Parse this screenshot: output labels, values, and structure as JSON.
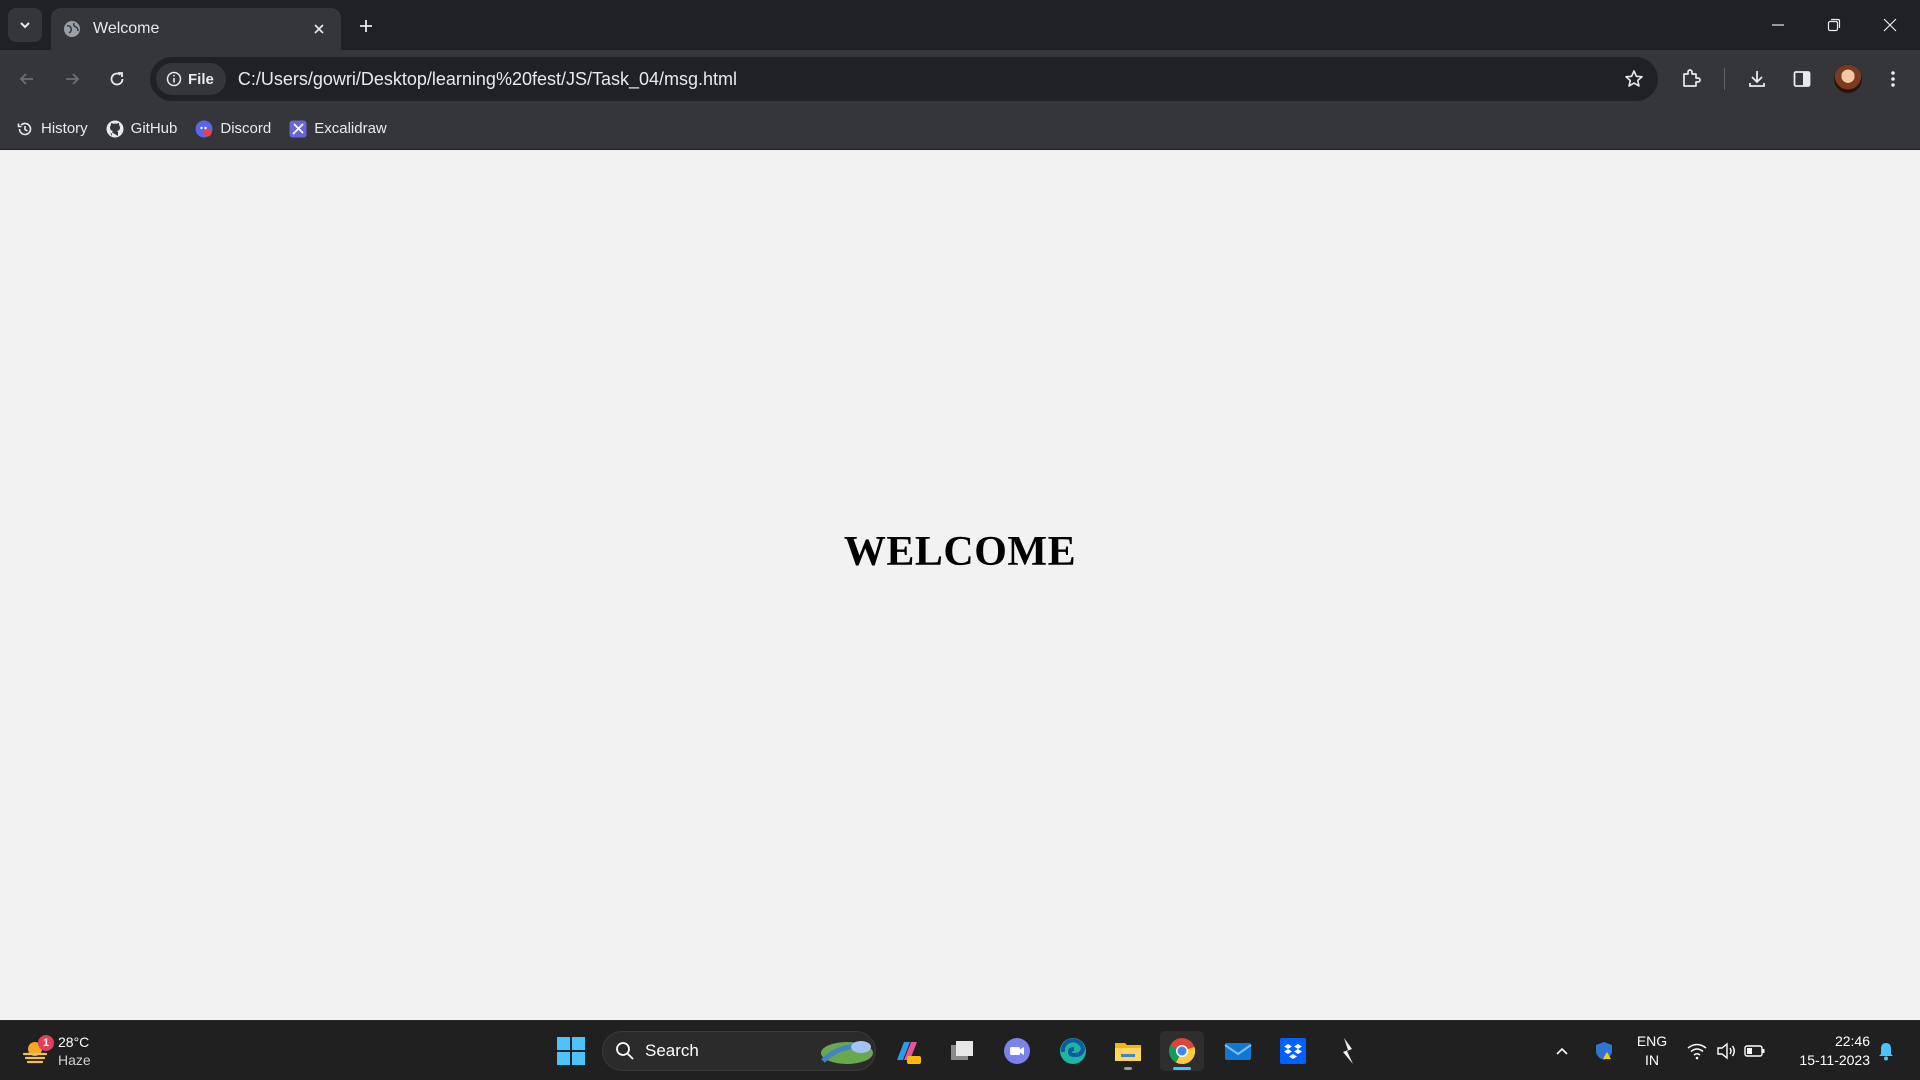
{
  "browser": {
    "tab": {
      "title": "Welcome"
    },
    "address": {
      "scheme_chip": "File",
      "url": "C:/Users/gowri/Desktop/learning%20fest/JS/Task_04/msg.html"
    },
    "bookmarks": [
      {
        "label": "History",
        "icon": "history-icon"
      },
      {
        "label": "GitHub",
        "icon": "github-icon"
      },
      {
        "label": "Discord",
        "icon": "discord-icon"
      },
      {
        "label": "Excalidraw",
        "icon": "excalidraw-icon"
      }
    ]
  },
  "page": {
    "heading": "WELCOME"
  },
  "taskbar": {
    "weather": {
      "temp": "28°C",
      "condition": "Haze",
      "badge": "1"
    },
    "search_label": "Search",
    "language": {
      "line1": "ENG",
      "line2": "IN"
    },
    "clock": {
      "time": "22:46",
      "date": "15-11-2023"
    }
  },
  "colors": {
    "titlebar": "#202124",
    "toolbar": "#35363a",
    "page_background": "#f2f2f2",
    "taskbar": "#202020",
    "accent_blue": "#4cc2ff"
  }
}
